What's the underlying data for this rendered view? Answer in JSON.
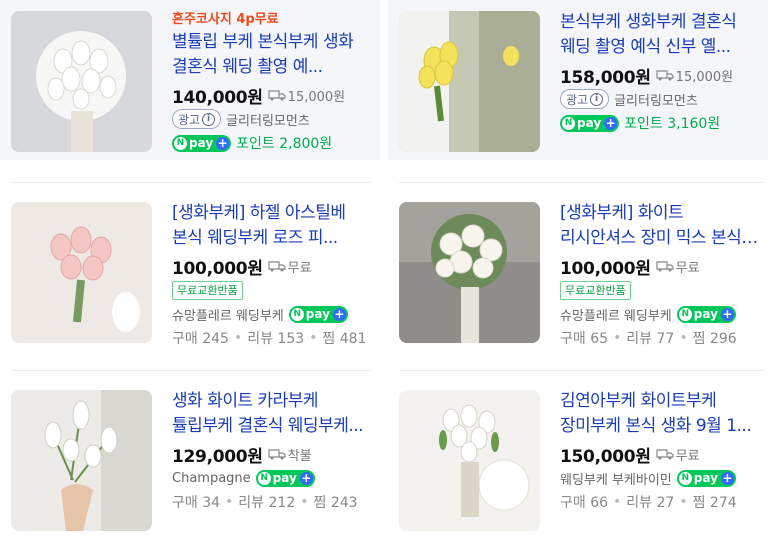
{
  "products": [
    {
      "promo": "혼주코사지 4p무료",
      "title": "별튤립 부케 본식부케 생화 결혼식 웨딩 촬영 예...",
      "price": "140,000원",
      "shipping": "15,000원",
      "ad_label": "광고",
      "seller": "글리터링모먼츠",
      "npay": "pay",
      "points": "포인트 2,800원"
    },
    {
      "title": "본식부케 생화부케 결혼식 웨딩 촬영 예식 신부 옐...",
      "price": "158,000원",
      "shipping": "15,000원",
      "ad_label": "광고",
      "seller": "글리터링모먼츠",
      "npay": "pay",
      "points": "포인트 3,160원"
    },
    {
      "title": "[생화부케] 하젤 아스틸베 본식 웨딩부케 로즈 피...",
      "price": "100,000원",
      "shipping": "무료",
      "badge": "무료교환반품",
      "seller": "슈망플레르 웨딩부케",
      "npay": "pay",
      "stats": {
        "buy": "구매 245",
        "review": "리뷰 153",
        "like": "찜 481"
      }
    },
    {
      "title": "[생화부케] 화이트 리시안셔스 장미 믹스 본식 예...",
      "price": "100,000원",
      "shipping": "무료",
      "badge": "무료교환반품",
      "seller": "슈망플레르 웨딩부케",
      "npay": "pay",
      "stats": {
        "buy": "구매 65",
        "review": "리뷰 77",
        "like": "찜 296"
      }
    },
    {
      "title": "생화 화이트 카라부케 튤립부케 결혼식 웨딩부케...",
      "price": "129,000원",
      "shipping": "착불",
      "seller": "Champagne",
      "npay": "pay",
      "stats": {
        "buy": "구매 34",
        "review": "리뷰 212",
        "like": "찜 243"
      }
    },
    {
      "title": "김연아부케 화이트부케 장미부케 본식 생화 9월 1...",
      "price": "150,000원",
      "shipping": "무료",
      "seller": "웨딩부케 부케바이민",
      "npay": "pay",
      "stats": {
        "buy": "구매 66",
        "review": "리뷰 27",
        "like": "찜 274"
      }
    }
  ],
  "colors": {
    "title": "#1a3cb5",
    "promo": "#f04a1c",
    "npay": "#03c75a",
    "point": "#03a94e",
    "ad_bg": "#f4f6fa"
  },
  "icons": {
    "shipping": "truck-icon",
    "ad_info": "info-icon",
    "npay_plus": "plus-icon"
  }
}
